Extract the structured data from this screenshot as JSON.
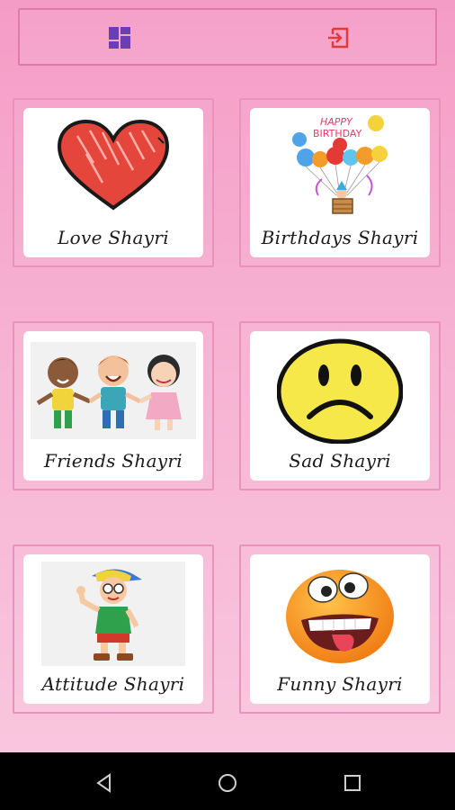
{
  "toolbar": {
    "dashboard_icon": "dashboard-icon",
    "logout_icon": "logout-icon",
    "dashboard_color": "#6a3fb5",
    "logout_color": "#e53935"
  },
  "categories": [
    {
      "label": "Love Shayri",
      "icon": "heart-icon"
    },
    {
      "label": "Birthdays Shayri",
      "icon": "birthday-balloons-icon"
    },
    {
      "label": "Friends Shayri",
      "icon": "friends-icon"
    },
    {
      "label": "Sad Shayri",
      "icon": "sad-face-icon"
    },
    {
      "label": "Attitude Shayri",
      "icon": "attitude-boy-icon"
    },
    {
      "label": "Funny Shayri",
      "icon": "funny-face-icon"
    }
  ],
  "birthday_card_text": {
    "line1": "HAPPY",
    "line2": "BIRTHDAY"
  },
  "navbar": {
    "back_icon": "back-icon",
    "home_icon": "home-icon",
    "recents_icon": "recents-icon"
  }
}
